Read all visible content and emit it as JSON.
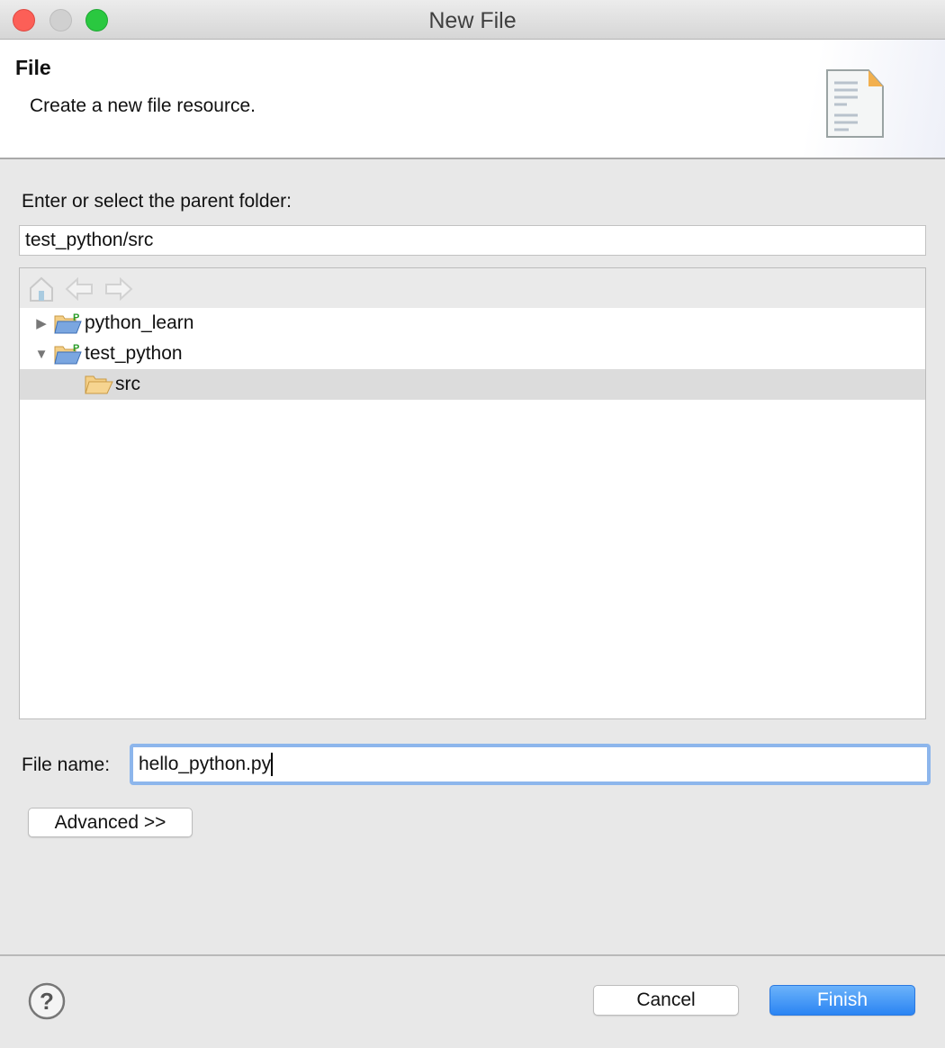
{
  "window": {
    "title": "New File"
  },
  "header": {
    "title": "File",
    "description": "Create a new file resource."
  },
  "parent_folder": {
    "label": "Enter or select the parent folder:",
    "value": "test_python/src"
  },
  "tree": {
    "items": [
      {
        "label": "python_learn",
        "expanded": false,
        "icon": "python-project-folder-icon"
      },
      {
        "label": "test_python",
        "expanded": true,
        "icon": "python-project-folder-icon"
      },
      {
        "label": "src",
        "selected": true,
        "icon": "source-folder-icon"
      }
    ]
  },
  "file_name": {
    "label": "File name:",
    "value": "hello_python.py"
  },
  "buttons": {
    "advanced": "Advanced >>",
    "cancel": "Cancel",
    "finish": "Finish"
  },
  "colors": {
    "accent": "#3d8ff5",
    "close": "#fc5f57",
    "maximize": "#2ac840"
  }
}
